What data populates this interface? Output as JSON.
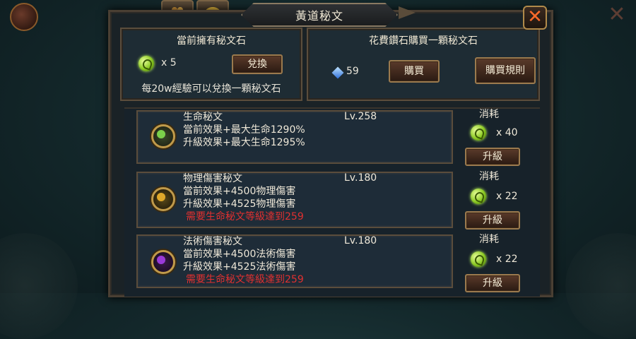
{
  "window": {
    "title": "黃道秘文",
    "close_label": "✕"
  },
  "owned": {
    "title": "當前擁有秘文石",
    "count": "x 5",
    "exchange_label": "兌換",
    "note": "每20w經驗可以兌換一顆秘文石"
  },
  "buy": {
    "title": "花費鑽石購買一顆秘文石",
    "price": "59",
    "buy_label": "購買",
    "rules_label": "購買規則"
  },
  "runes": [
    {
      "name": "生命秘文",
      "level": "Lv.258",
      "current": "當前效果+最大生命1290%",
      "next": "升級效果+最大生命1295%",
      "requirement": "",
      "cost_label": "消耗",
      "cost": "x 40",
      "upgrade_label": "升級",
      "icon_color": "#7bd04a"
    },
    {
      "name": "物理傷害秘文",
      "level": "Lv.180",
      "current": "當前效果+4500物理傷害",
      "next": "升級效果+4525物理傷害",
      "requirement": "需要生命秘文等級達到259",
      "cost_label": "消耗",
      "cost": "x 22",
      "upgrade_label": "升級",
      "icon_color": "#e0a82a"
    },
    {
      "name": "法術傷害秘文",
      "level": "Lv.180",
      "current": "當前效果+4500法術傷害",
      "next": "升級效果+4525法術傷害",
      "requirement": "需要生命秘文等級達到259",
      "cost_label": "消耗",
      "cost": "x 22",
      "upgrade_label": "升級",
      "icon_color": "#9a3ad8"
    }
  ],
  "colors": {
    "requirement_text": "#e03030",
    "gem": "#9ad83a",
    "close": "#ff6a2a"
  }
}
